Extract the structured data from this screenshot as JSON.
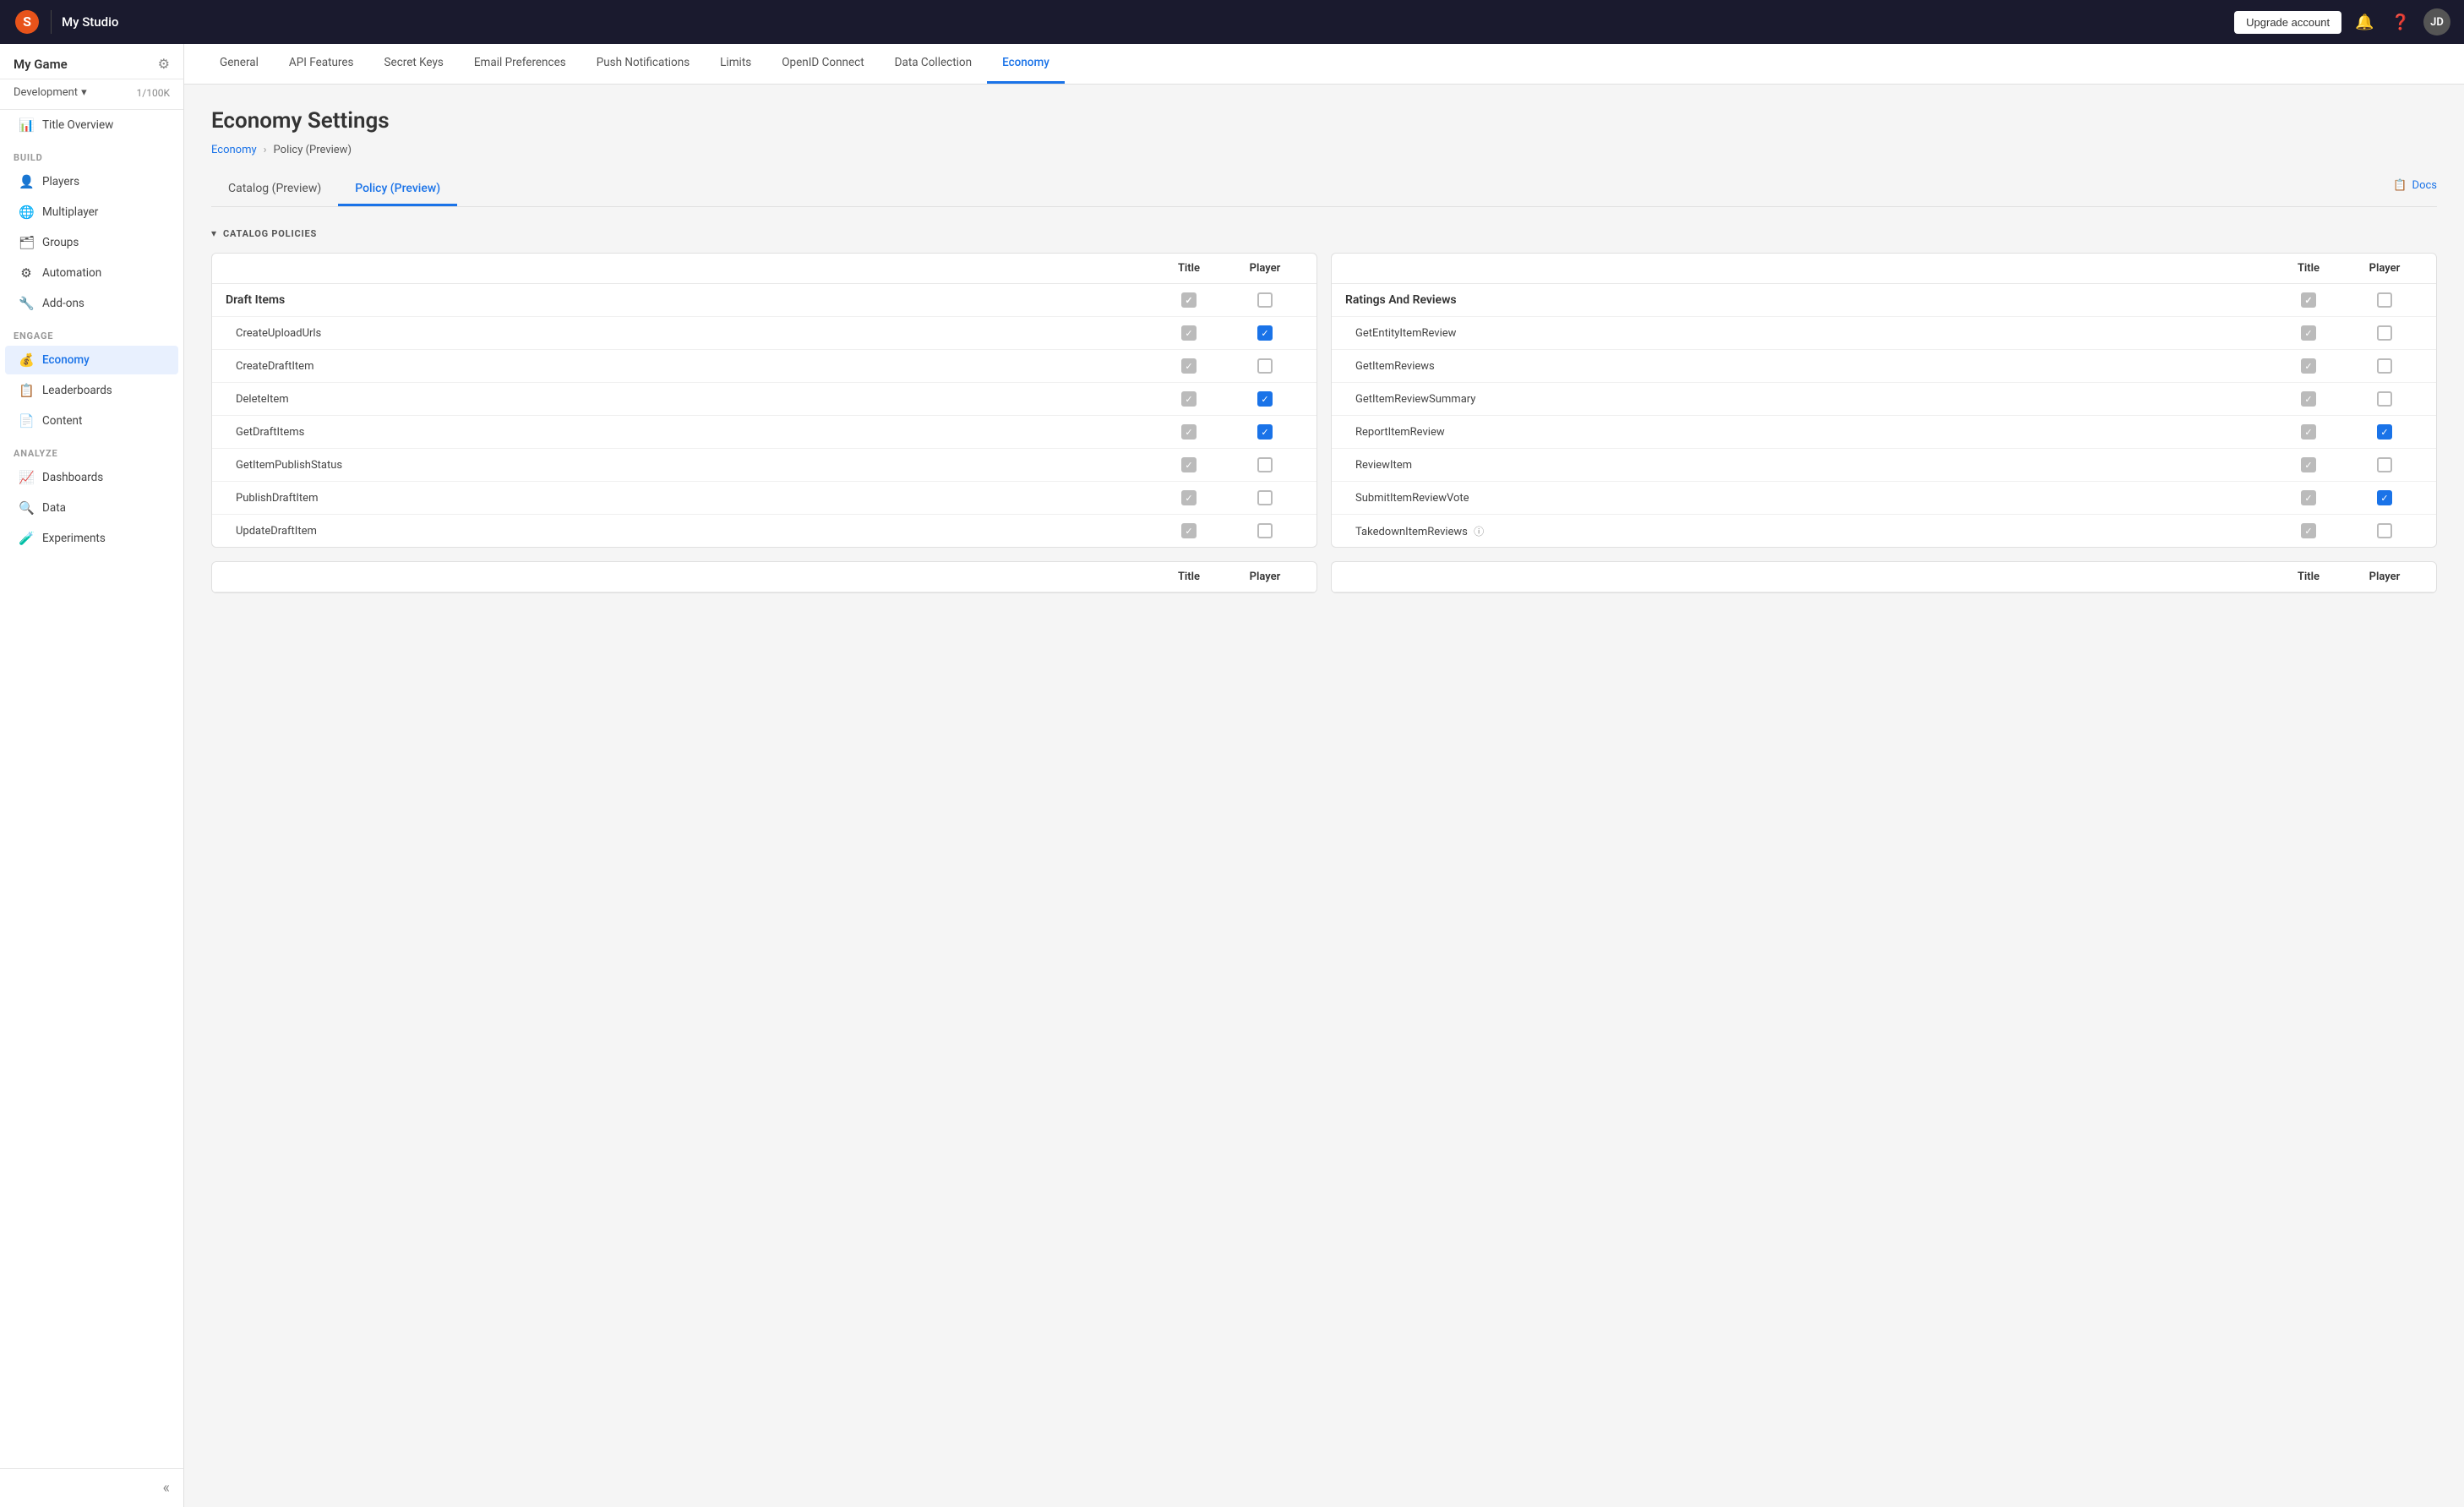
{
  "topbar": {
    "title": "My Studio",
    "upgrade_label": "Upgrade account",
    "avatar": "JD"
  },
  "sidebar": {
    "game_name": "My Game",
    "environment": "Development",
    "env_count": "1/100K",
    "sections": [
      {
        "label": "",
        "items": [
          {
            "id": "title-overview",
            "label": "Title Overview",
            "icon": "📊"
          }
        ]
      },
      {
        "label": "Build",
        "items": [
          {
            "id": "players",
            "label": "Players",
            "icon": "👤"
          },
          {
            "id": "multiplayer",
            "label": "Multiplayer",
            "icon": "🌐"
          },
          {
            "id": "groups",
            "label": "Groups",
            "icon": "🗂"
          },
          {
            "id": "automation",
            "label": "Automation",
            "icon": "⚙"
          },
          {
            "id": "addons",
            "label": "Add-ons",
            "icon": "🔧"
          }
        ]
      },
      {
        "label": "Engage",
        "items": [
          {
            "id": "economy",
            "label": "Economy",
            "icon": "💰",
            "active": true
          },
          {
            "id": "leaderboards",
            "label": "Leaderboards",
            "icon": "📋"
          },
          {
            "id": "content",
            "label": "Content",
            "icon": "📄"
          }
        ]
      },
      {
        "label": "Analyze",
        "items": [
          {
            "id": "dashboards",
            "label": "Dashboards",
            "icon": "📈"
          },
          {
            "id": "data",
            "label": "Data",
            "icon": "🔍"
          },
          {
            "id": "experiments",
            "label": "Experiments",
            "icon": "🧪"
          }
        ]
      }
    ]
  },
  "tabs": [
    {
      "id": "general",
      "label": "General"
    },
    {
      "id": "api-features",
      "label": "API Features"
    },
    {
      "id": "secret-keys",
      "label": "Secret Keys"
    },
    {
      "id": "email-preferences",
      "label": "Email Preferences"
    },
    {
      "id": "push-notifications",
      "label": "Push Notifications"
    },
    {
      "id": "limits",
      "label": "Limits"
    },
    {
      "id": "openid-connect",
      "label": "OpenID Connect"
    },
    {
      "id": "data-collection",
      "label": "Data Collection"
    },
    {
      "id": "economy",
      "label": "Economy",
      "active": true
    }
  ],
  "page": {
    "title": "Economy Settings",
    "breadcrumb_parent": "Economy",
    "breadcrumb_current": "Policy (Preview)"
  },
  "sub_tabs": [
    {
      "id": "catalog-preview",
      "label": "Catalog (Preview)"
    },
    {
      "id": "policy-preview",
      "label": "Policy (Preview)",
      "active": true
    }
  ],
  "docs_label": "Docs",
  "section_title": "CATALOG POLICIES",
  "left_table": {
    "group_label": "Draft Items",
    "rows": [
      {
        "label": "CreateUploadUrls",
        "title_checked": "gray",
        "player_checked": "blue"
      },
      {
        "label": "CreateDraftItem",
        "title_checked": "gray",
        "player_checked": "none"
      },
      {
        "label": "DeleteItem",
        "title_checked": "gray",
        "player_checked": "blue"
      },
      {
        "label": "GetDraftItems",
        "title_checked": "gray",
        "player_checked": "blue"
      },
      {
        "label": "GetItemPublishStatus",
        "title_checked": "gray",
        "player_checked": "none"
      },
      {
        "label": "PublishDraftItem",
        "title_checked": "gray",
        "player_checked": "none"
      },
      {
        "label": "UpdateDraftItem",
        "title_checked": "gray",
        "player_checked": "none"
      }
    ]
  },
  "right_table": {
    "group_label": "Ratings And Reviews",
    "rows": [
      {
        "label": "GetEntityItemReview",
        "title_checked": "gray",
        "player_checked": "none"
      },
      {
        "label": "GetItemReviews",
        "title_checked": "gray",
        "player_checked": "none"
      },
      {
        "label": "GetItemReviewSummary",
        "title_checked": "gray",
        "player_checked": "none"
      },
      {
        "label": "ReportItemReview",
        "title_checked": "gray",
        "player_checked": "blue"
      },
      {
        "label": "ReviewItem",
        "title_checked": "gray",
        "player_checked": "none"
      },
      {
        "label": "SubmitItemReviewVote",
        "title_checked": "gray",
        "player_checked": "blue"
      },
      {
        "label": "TakedownItemReviews",
        "title_checked": "gray",
        "player_checked": "none",
        "has_info": true
      }
    ]
  },
  "bottom_table_left": {
    "col_title": "Title",
    "col_player": "Player"
  },
  "bottom_table_right": {
    "col_title": "Title",
    "col_player": "Player"
  }
}
